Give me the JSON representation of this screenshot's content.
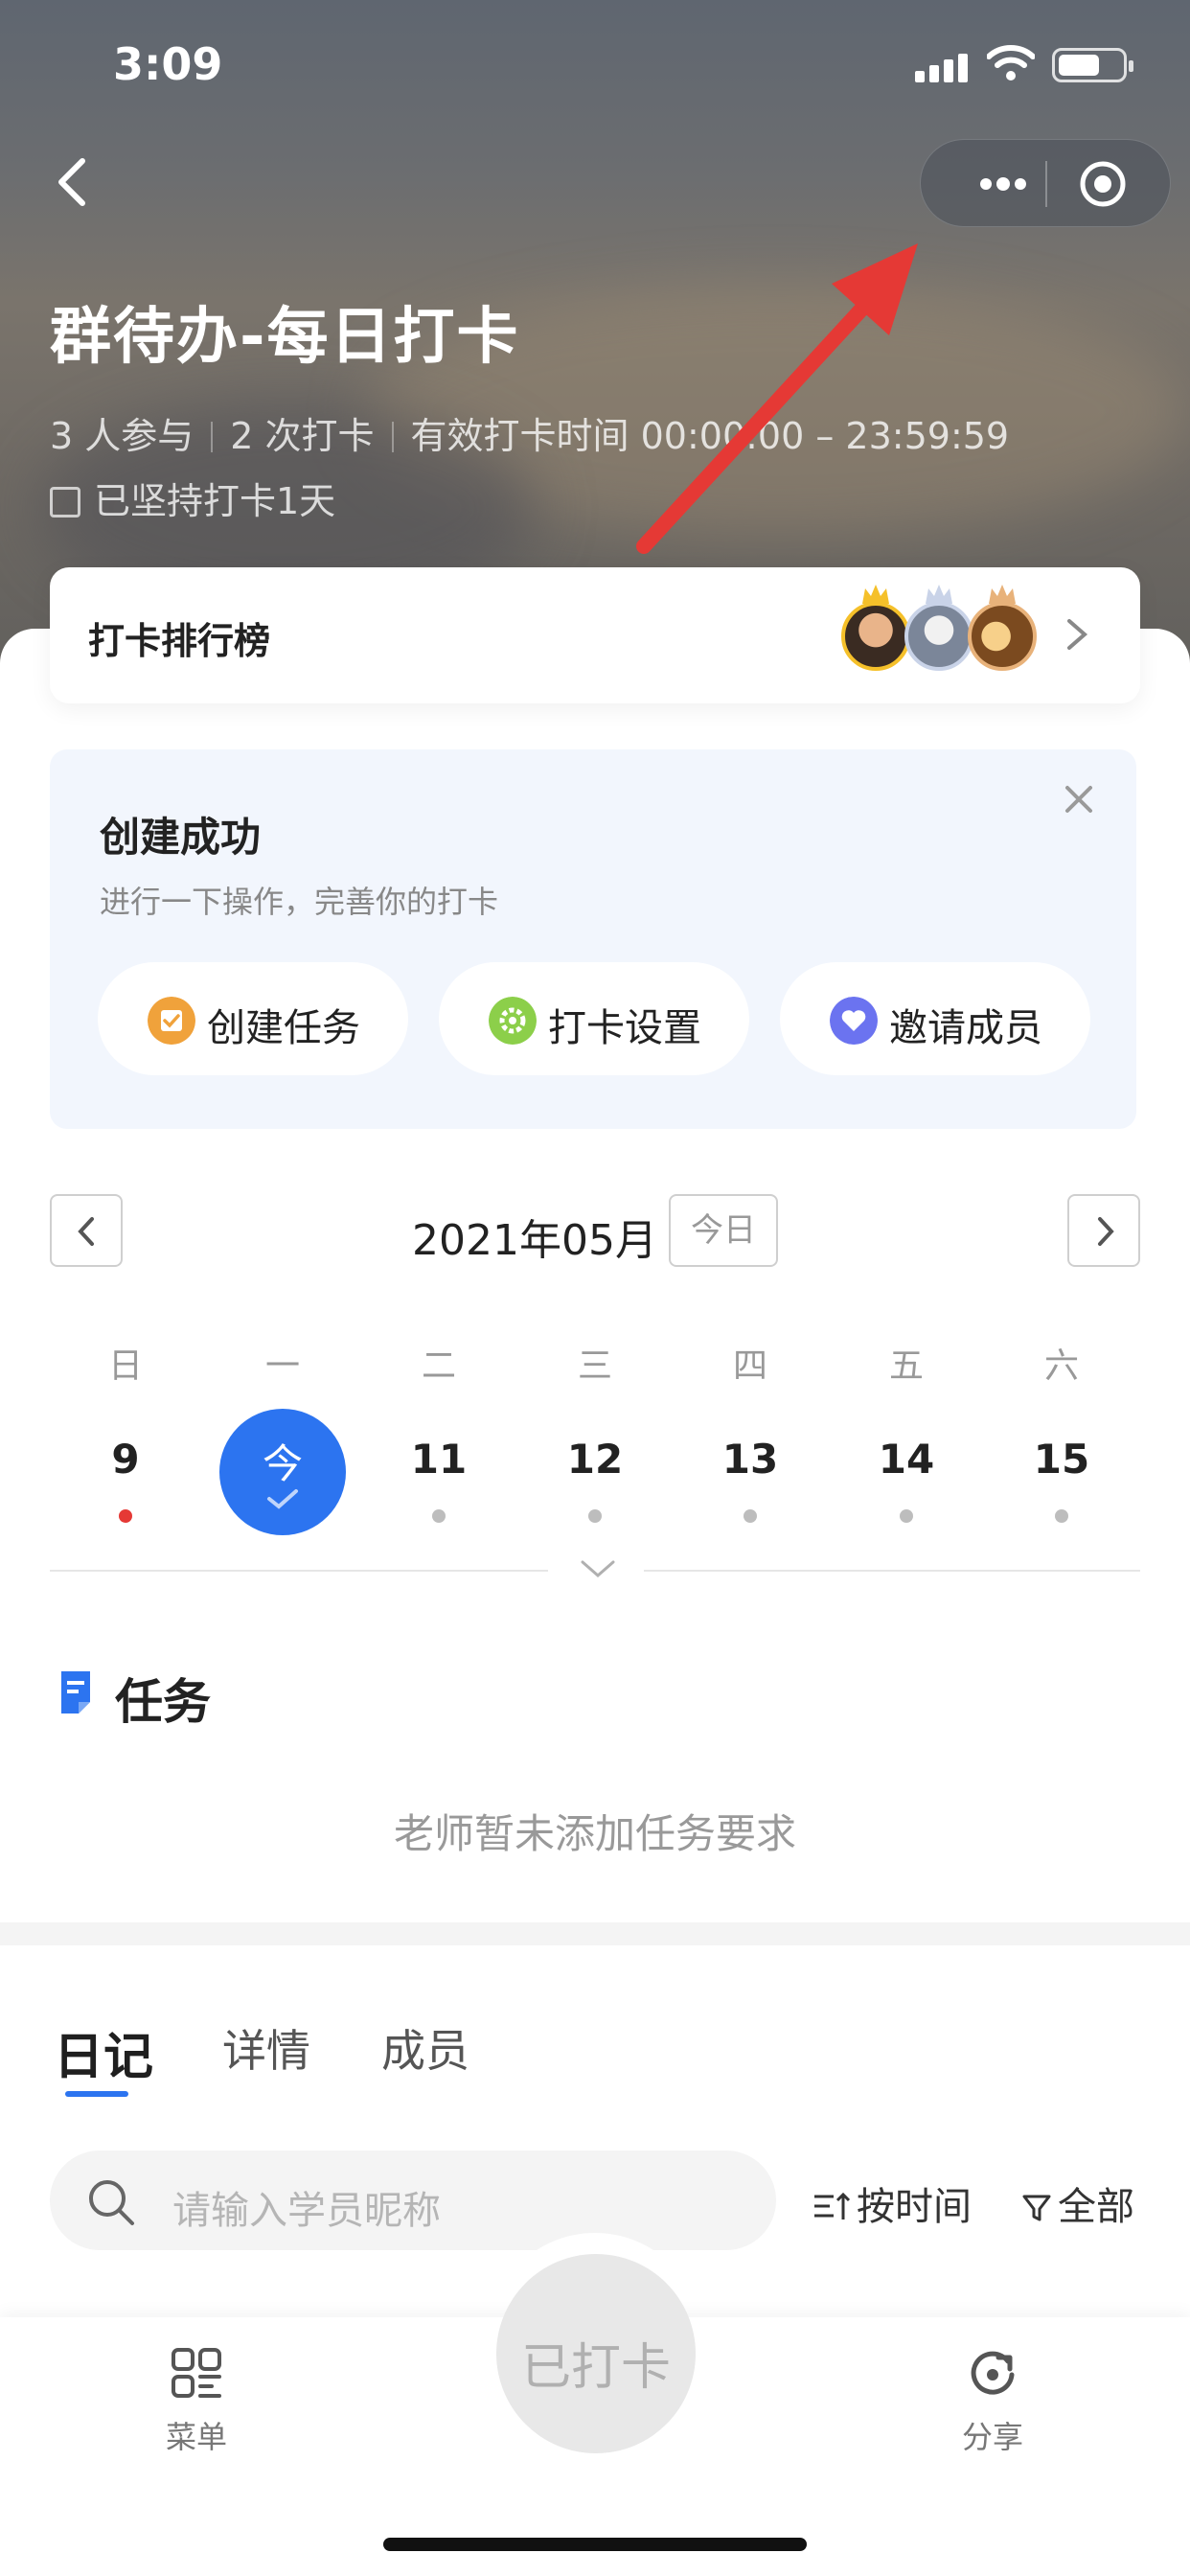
{
  "status_bar": {
    "time": "3:09"
  },
  "header": {
    "title": "群待办-每日打卡",
    "meta": [
      "3 人参与",
      "2 次打卡",
      "有效打卡时间 00:00:00 – 23:59:59"
    ],
    "streak": "已坚持打卡1天"
  },
  "rank": {
    "label": "打卡排行榜"
  },
  "success_card": {
    "title": "创建成功",
    "subtitle": "进行一下操作，完善你的打卡",
    "actions": [
      {
        "label": "创建任务",
        "icon": "task-icon",
        "color": "#f0a23b"
      },
      {
        "label": "打卡设置",
        "icon": "settings-icon",
        "color": "#8ccf4a"
      },
      {
        "label": "邀请成员",
        "icon": "heart-icon",
        "color": "#6b73f0"
      }
    ]
  },
  "calendar": {
    "month": "2021年05月",
    "today_label": "今日",
    "weekdays": [
      "日",
      "一",
      "二",
      "三",
      "四",
      "五",
      "六"
    ],
    "days": [
      "9",
      "今",
      "11",
      "12",
      "13",
      "14",
      "15"
    ],
    "accent": "#2c74f0"
  },
  "task": {
    "title": "任务",
    "empty_text": "老师暂未添加任务要求"
  },
  "tabs": [
    "日记",
    "详情",
    "成员"
  ],
  "search": {
    "placeholder": "请输入学员昵称"
  },
  "sort_label": "按时间",
  "filter_label": "全部",
  "bottom": {
    "menu": "菜单",
    "checkin": "已打卡",
    "share": "分享"
  }
}
